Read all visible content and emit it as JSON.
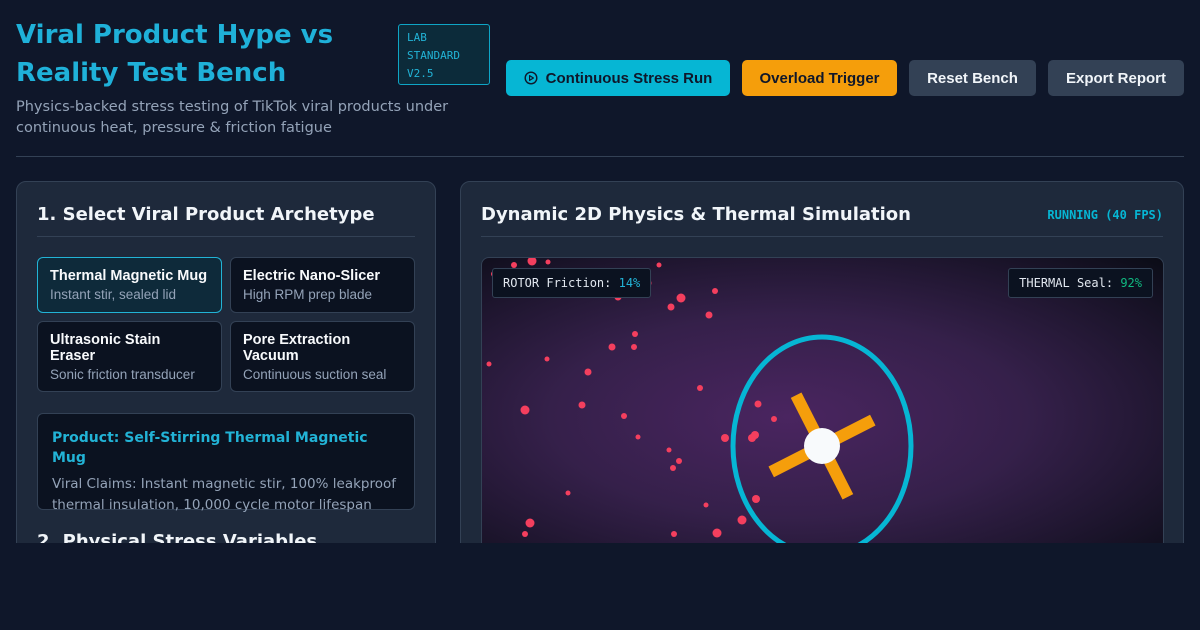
{
  "header": {
    "title": "Viral Product Hype vs Reality Test Bench",
    "badge": "LAB STANDARD V2.5",
    "subtitle": "Physics-backed stress testing of TikTok viral products under continuous heat, pressure & friction fatigue"
  },
  "toolbar": {
    "stress_label": "Continuous Stress Run",
    "overload_label": "Overload Trigger",
    "reset_label": "Reset Bench",
    "export_label": "Export Report"
  },
  "left_panel": {
    "heading": "1. Select Viral Product Archetype",
    "archetypes": [
      {
        "name": "Thermal Magnetic Mug",
        "desc": "Instant stir, sealed lid",
        "active": true
      },
      {
        "name": "Electric Nano-Slicer",
        "desc": "High RPM prep blade",
        "active": false
      },
      {
        "name": "Ultrasonic Stain Eraser",
        "desc": "Sonic friction transducer",
        "active": false
      },
      {
        "name": "Pore Extraction Vacuum",
        "desc": "Continuous suction seal",
        "active": false
      }
    ],
    "product": {
      "name": "Product: Self-Stirring Thermal Magnetic Mug",
      "claims": "Viral Claims: Instant magnetic stir, 100% leakproof thermal insulation, 10,000 cycle motor lifespan"
    },
    "section2_heading": "2. Physical Stress Variables"
  },
  "right_panel": {
    "heading": "Dynamic 2D Physics & Thermal Simulation",
    "status": "RUNNING (40 FPS)",
    "rotor_label": "ROTOR Friction:",
    "rotor_value": "14%",
    "thermal_label": "THERMAL Seal:",
    "thermal_value": "92%"
  },
  "colors": {
    "accent": "#06b6d4",
    "warning": "#f59e0b",
    "particle": "#f43f5e",
    "ring": "#06b6d4",
    "blades": "#f59e0b"
  }
}
